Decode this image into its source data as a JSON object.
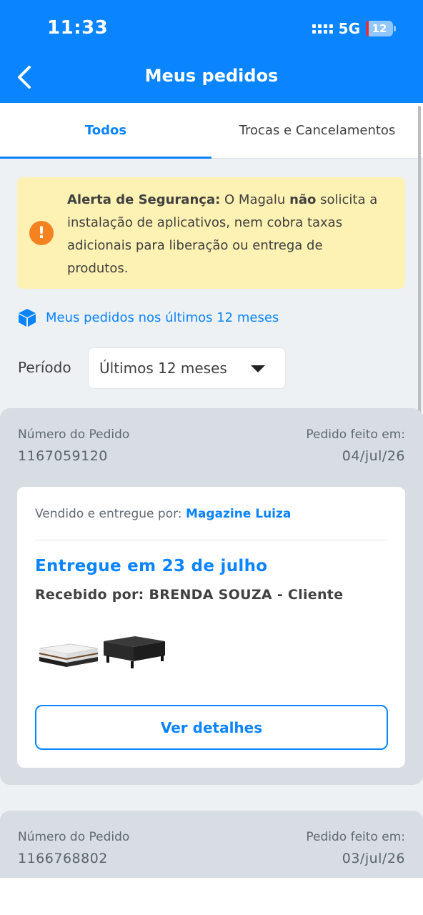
{
  "status_bar": {
    "time": "11:33",
    "network": "5G",
    "battery": "12"
  },
  "header": {
    "title": "Meus pedidos",
    "back_icon": "chevron-left-icon"
  },
  "tabs": [
    {
      "label": "Todos",
      "active": true
    },
    {
      "label": "Trocas e Cancelamentos",
      "active": false
    }
  ],
  "alert": {
    "title": "Alerta de Segurança:",
    "text_1": " O Magalu ",
    "emphasis": "não",
    "text_2": " solicita a instalação de aplicativos, nem cobra taxas adicionais para liberação ou entrega de produtos."
  },
  "recent": {
    "label": "Meus pedidos nos últimos 12 meses",
    "icon": "box-icon"
  },
  "filter": {
    "label": "Período",
    "selected": "Últimos 12 meses"
  },
  "orders": [
    {
      "number_label": "Número do Pedido",
      "number": "1167059120",
      "date_label": "Pedido feito em:",
      "date": "04/jul/26",
      "sold_by_label": "Vendido e entregue por:",
      "seller": "Magazine Luiza",
      "status": "Entregue em 23 de julho",
      "received_by": "Recebido por: BRENDA SOUZA - Cliente",
      "details_button": "Ver detalhes"
    },
    {
      "number_label": "Número do Pedido",
      "number": "1166768802",
      "date_label": "Pedido feito em:",
      "date": "03/jul/26"
    }
  ],
  "colors": {
    "brand": "#0a84ff",
    "alert_bg": "#fdf1b3",
    "alert_icon": "#f58220"
  }
}
